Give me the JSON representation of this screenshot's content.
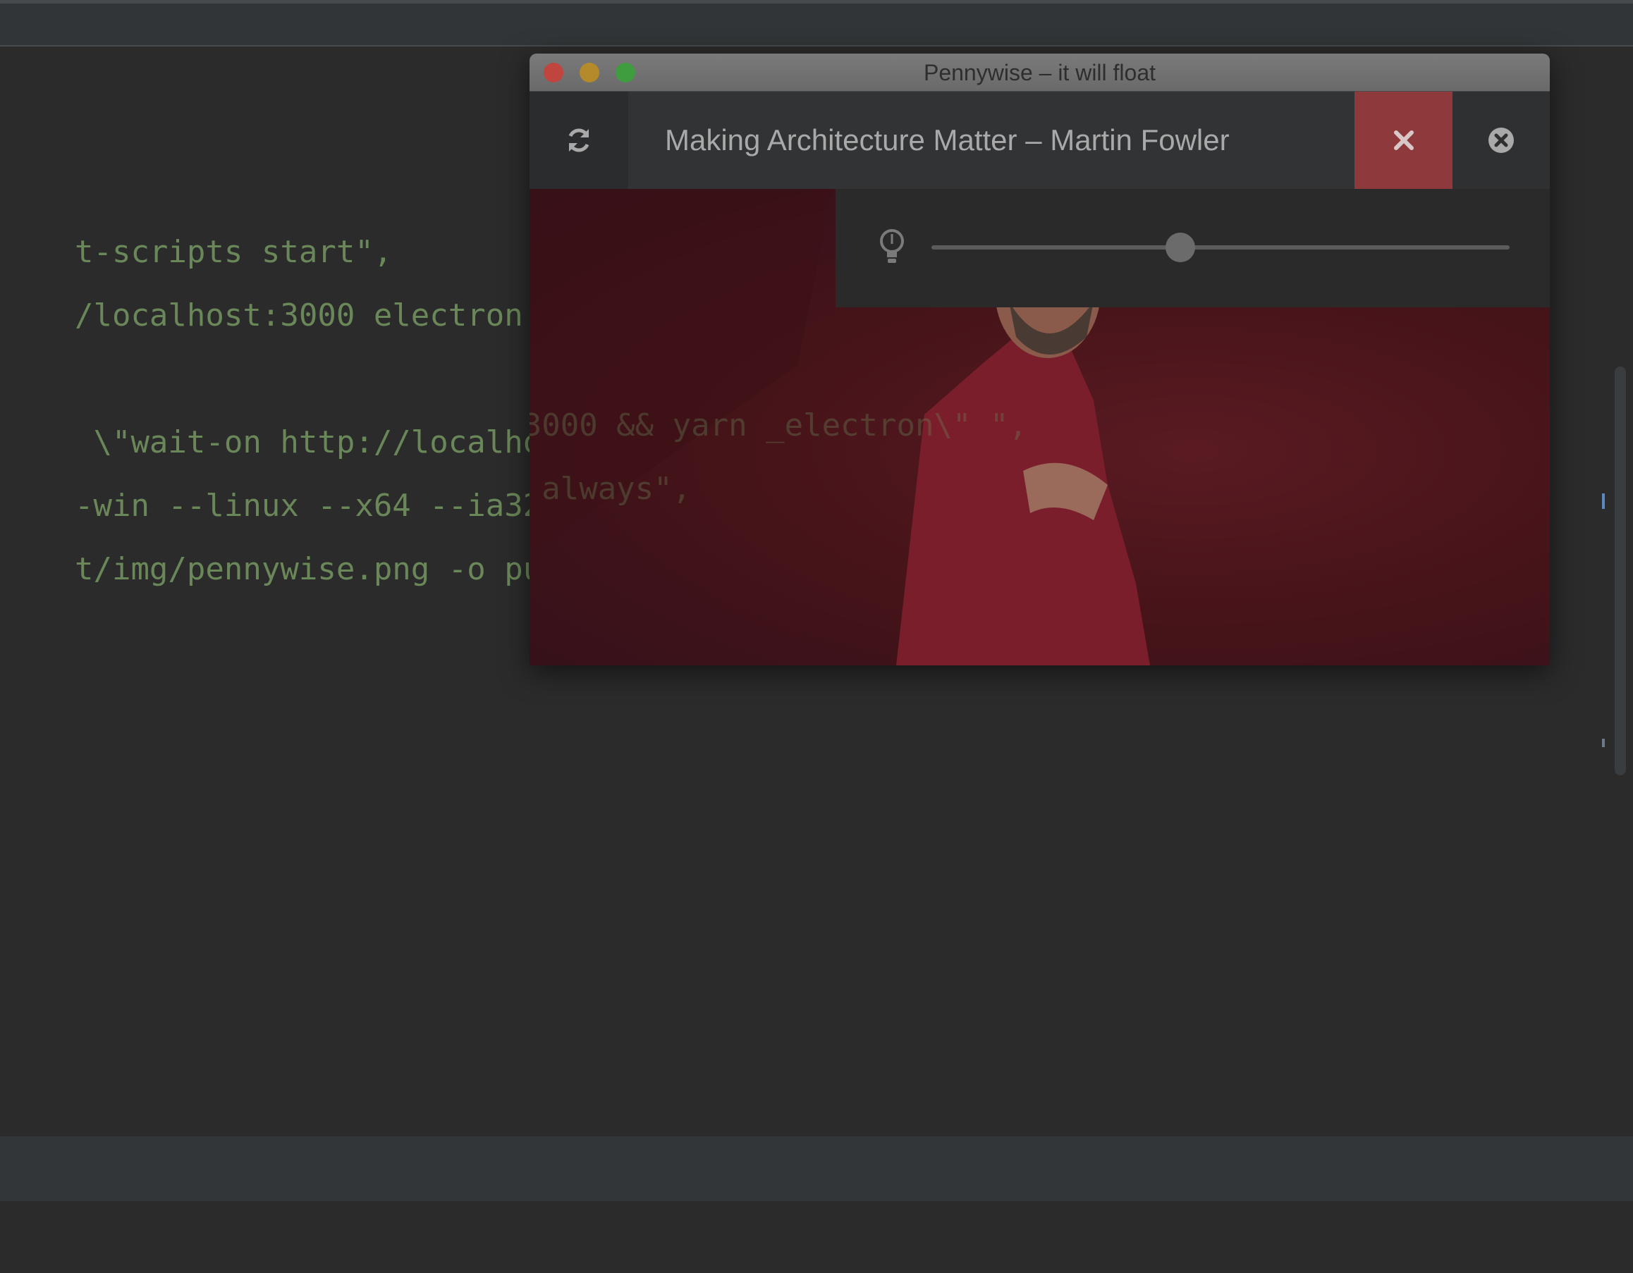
{
  "editor": {
    "lines": [
      {
        "id": "l1",
        "text": "t-scripts start\","
      },
      {
        "id": "l2",
        "text": "/localhost:3000 electron .\","
      },
      {
        "id": "l3a",
        "text": " \\\"wait-on http://localhost:3000 && yarn _electron\\\" \","
      },
      {
        "id": "l4",
        "text": "-win --linux --x64 --ia32 -p always\","
      },
      {
        "id": "l5",
        "text": "t/img/pennywise.png -o public\""
      }
    ]
  },
  "pennywise": {
    "window_title": "Pennywise – it will float",
    "video_title": "Making Architecture Matter – Martin Fowler",
    "opacity_value": 0.43,
    "icons": {
      "refresh": "refresh-icon",
      "close_video": "close-icon",
      "close_window": "close-circle-icon",
      "opacity": "lightbulb-icon"
    }
  },
  "colors": {
    "close_red": "#8e3a3c",
    "traffic_red": "#c0453e",
    "traffic_yellow": "#b58a2a",
    "traffic_green": "#3f9d3f",
    "string_green": "#6a8759",
    "escape_orange": "#cc7832"
  }
}
